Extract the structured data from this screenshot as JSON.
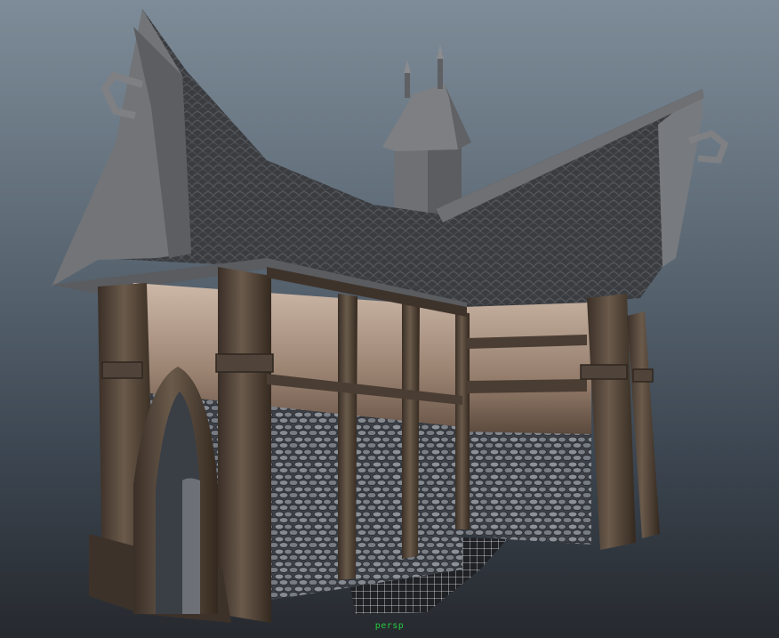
{
  "viewport": {
    "camera_label": "persp"
  },
  "scene": {
    "object": "medieval-house-model",
    "colors": {
      "roof_tile": "#3b3d40",
      "roof_trim": "#6e7073",
      "plaster": "#8b7566",
      "timber": "#4c3f34",
      "stone": "#5a5f66",
      "spire": "#737578",
      "ground_grid": "#e6e8ec"
    }
  }
}
